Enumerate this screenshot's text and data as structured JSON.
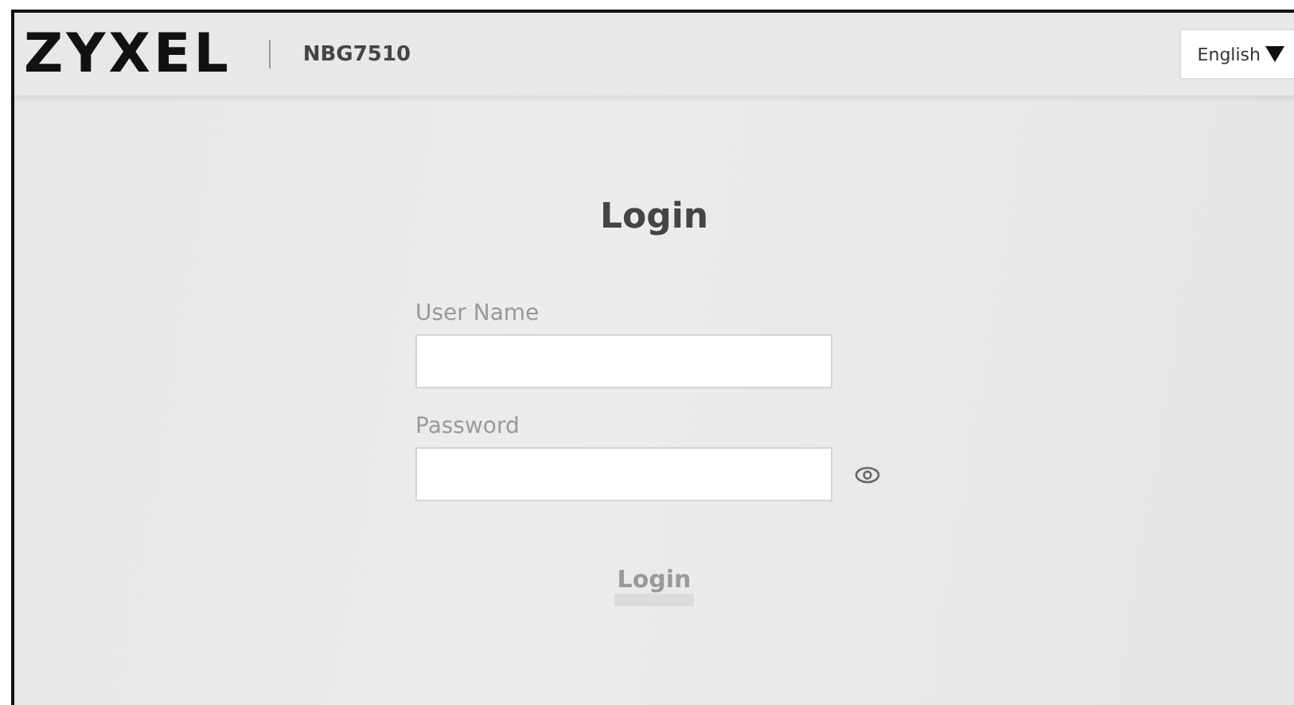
{
  "header": {
    "logo": "ZYXEL",
    "model": "NBG7510",
    "language": "English"
  },
  "login": {
    "title": "Login",
    "fields": [
      {
        "label": "User Name",
        "kind": "text"
      },
      {
        "label": "Password",
        "kind": "password"
      }
    ],
    "button": "Login"
  }
}
